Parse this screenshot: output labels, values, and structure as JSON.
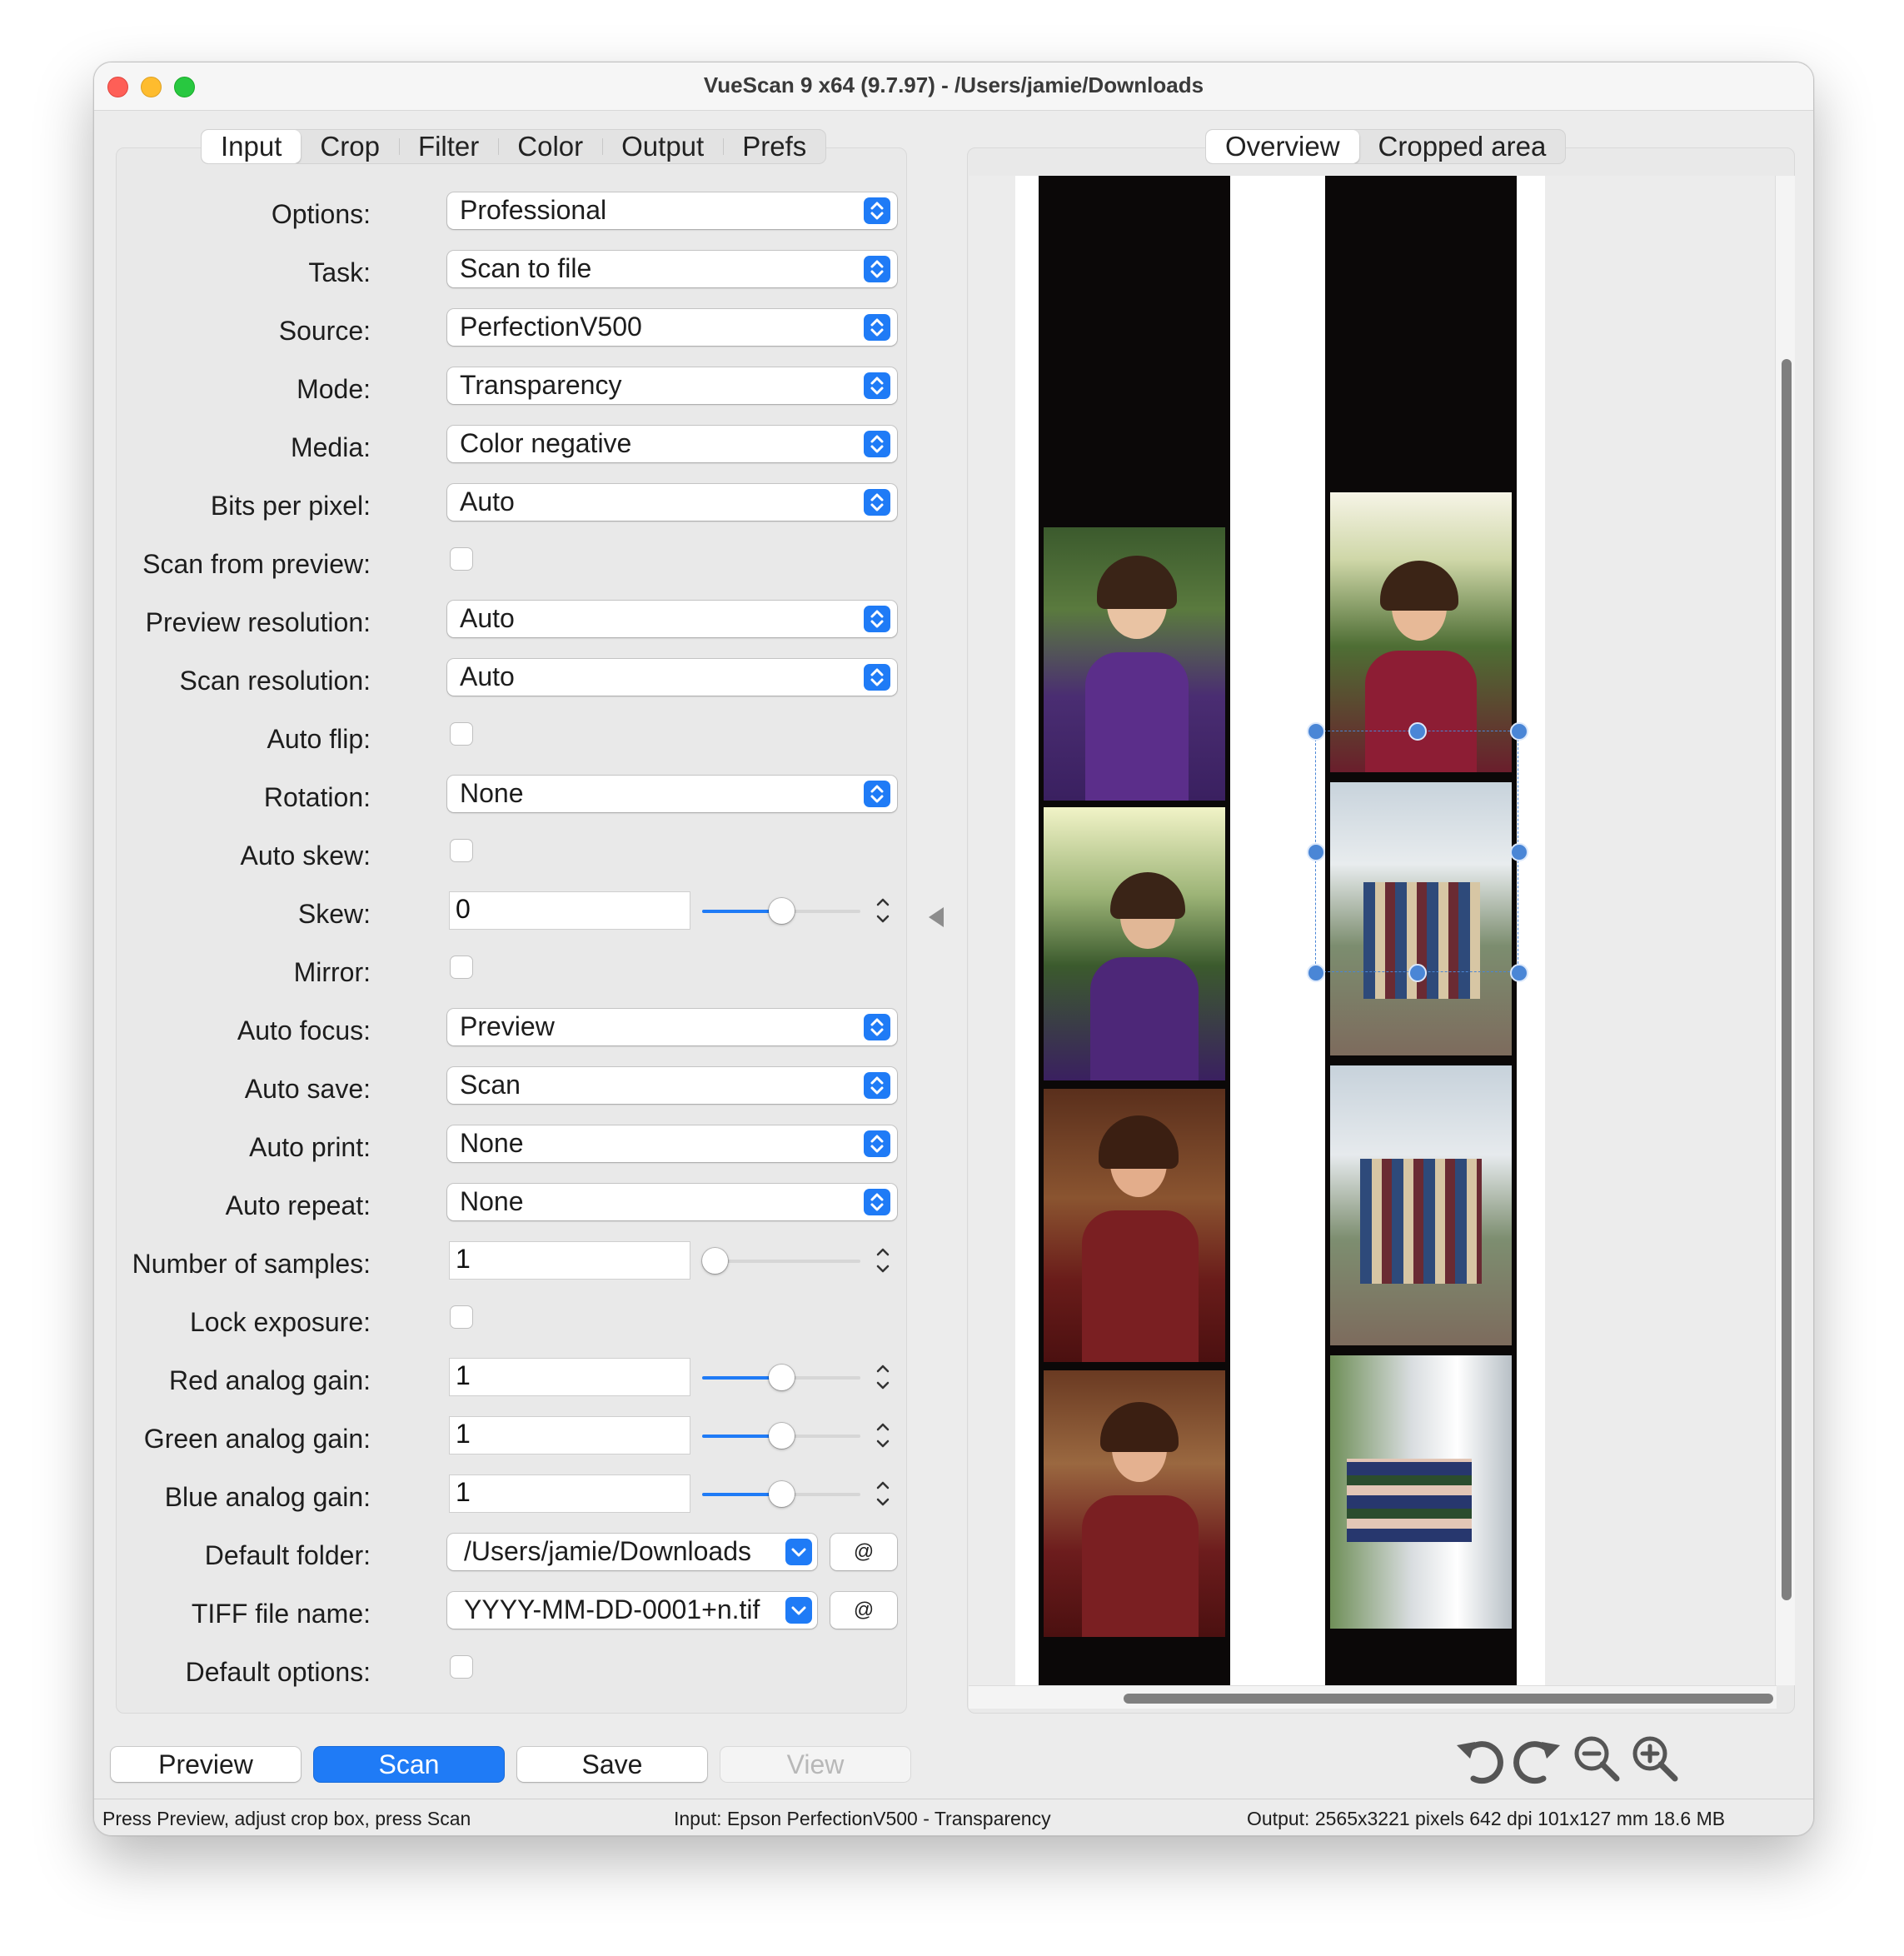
{
  "window": {
    "title": "VueScan 9 x64 (9.7.97) - /Users/jamie/Downloads"
  },
  "left_tabs": [
    {
      "label": "Input"
    },
    {
      "label": "Crop"
    },
    {
      "label": "Filter"
    },
    {
      "label": "Color"
    },
    {
      "label": "Output"
    },
    {
      "label": "Prefs"
    }
  ],
  "right_tabs": [
    {
      "label": "Overview"
    },
    {
      "label": "Cropped area"
    }
  ],
  "form": {
    "options": {
      "label": "Options:",
      "value": "Professional"
    },
    "task": {
      "label": "Task:",
      "value": "Scan to file"
    },
    "source": {
      "label": "Source:",
      "value": "PerfectionV500"
    },
    "mode": {
      "label": "Mode:",
      "value": "Transparency"
    },
    "media": {
      "label": "Media:",
      "value": "Color negative"
    },
    "bits_per_pixel": {
      "label": "Bits per pixel:",
      "value": "Auto"
    },
    "scan_from_preview": {
      "label": "Scan from preview:",
      "checked": false
    },
    "preview_resolution": {
      "label": "Preview resolution:",
      "value": "Auto"
    },
    "scan_resolution": {
      "label": "Scan resolution:",
      "value": "Auto"
    },
    "auto_flip": {
      "label": "Auto flip:",
      "checked": false
    },
    "rotation": {
      "label": "Rotation:",
      "value": "None"
    },
    "auto_skew": {
      "label": "Auto skew:",
      "checked": false
    },
    "skew": {
      "label": "Skew:",
      "value": "0",
      "slider_fraction": 0.5
    },
    "mirror": {
      "label": "Mirror:",
      "checked": false
    },
    "auto_focus": {
      "label": "Auto focus:",
      "value": "Preview"
    },
    "auto_save": {
      "label": "Auto save:",
      "value": "Scan"
    },
    "auto_print": {
      "label": "Auto print:",
      "value": "None"
    },
    "auto_repeat": {
      "label": "Auto repeat:",
      "value": "None"
    },
    "number_of_samples": {
      "label": "Number of samples:",
      "value": "1",
      "slider_fraction": 0.0
    },
    "lock_exposure": {
      "label": "Lock exposure:",
      "checked": false
    },
    "red_analog_gain": {
      "label": "Red analog gain:",
      "value": "1",
      "slider_fraction": 0.5
    },
    "green_analog_gain": {
      "label": "Green analog gain:",
      "value": "1",
      "slider_fraction": 0.5
    },
    "blue_analog_gain": {
      "label": "Blue analog gain:",
      "value": "1",
      "slider_fraction": 0.5
    },
    "default_folder": {
      "label": "Default folder:",
      "value": "/Users/jamie/Downloads",
      "button": "@"
    },
    "tiff_file_name": {
      "label": "TIFF file name:",
      "value": "YYYY-MM-DD-0001+n.tif",
      "button": "@"
    },
    "default_options": {
      "label": "Default options:",
      "checked": false
    }
  },
  "buttons": {
    "preview": "Preview",
    "scan": "Scan",
    "save": "Save",
    "view": "View"
  },
  "toolbar_icons": [
    "rotate-left-icon",
    "rotate-right-icon",
    "zoom-out-icon",
    "zoom-in-icon"
  ],
  "status": {
    "left": "Press Preview, adjust crop box, press Scan",
    "center": "Input: Epson PerfectionV500 - Transparency",
    "right": "Output: 2565x3221 pixels 642 dpi 101x127 mm 18.6 MB"
  },
  "colors": {
    "accent": "#1f7bf6",
    "window_bg": "#ececec",
    "crop_handle": "#4a86d6"
  }
}
